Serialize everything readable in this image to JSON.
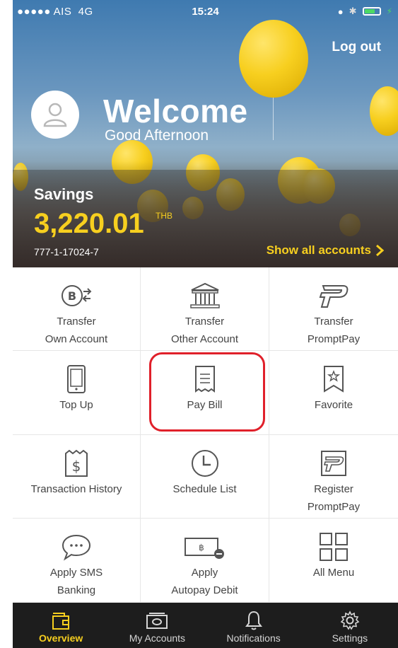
{
  "status_bar": {
    "carrier": "●●●●● AIS",
    "network": "4G",
    "time": "15:24"
  },
  "header": {
    "logout_label": "Log out",
    "welcome": "Welcome",
    "greeting": "Good Afternoon"
  },
  "account": {
    "name": "Savings",
    "balance": "3,220.01",
    "currency": "THB",
    "number": "777-1-17024-7",
    "show_all_label": "Show all accounts"
  },
  "menu": [
    {
      "line1": "Transfer",
      "line2": "Own Account",
      "icon": "baht-transfer-icon"
    },
    {
      "line1": "Transfer",
      "line2": "Other Account",
      "icon": "bank-icon"
    },
    {
      "line1": "Transfer",
      "line2": "PromptPay",
      "icon": "promptpay-icon"
    },
    {
      "line1": "Top Up",
      "line2": "",
      "icon": "mobile-icon"
    },
    {
      "line1": "Pay Bill",
      "line2": "",
      "icon": "receipt-icon"
    },
    {
      "line1": "Favorite",
      "line2": "",
      "icon": "star-bookmark-icon"
    },
    {
      "line1": "Transaction History",
      "line2": "",
      "icon": "dollar-receipt-icon"
    },
    {
      "line1": "Schedule List",
      "line2": "",
      "icon": "clock-icon"
    },
    {
      "line1": "Register",
      "line2": "PromptPay",
      "icon": "register-promptpay-icon"
    },
    {
      "line1": "Apply SMS",
      "line2": "Banking",
      "icon": "chat-bubble-icon"
    },
    {
      "line1": "Apply",
      "line2": "Autopay Debit",
      "icon": "autopay-card-icon"
    },
    {
      "line1": "All Menu",
      "line2": "",
      "icon": "grid-icon"
    }
  ],
  "tabs": [
    {
      "label": "Overview",
      "icon": "wallet-icon",
      "active": true
    },
    {
      "label": "My Accounts",
      "icon": "money-icon",
      "active": false
    },
    {
      "label": "Notifications",
      "icon": "bell-icon",
      "active": false
    },
    {
      "label": "Settings",
      "icon": "gear-icon",
      "active": false
    }
  ],
  "colors": {
    "accent": "#f7cf1f",
    "highlight": "#e0202a",
    "tabbar": "#1d1d1d"
  }
}
